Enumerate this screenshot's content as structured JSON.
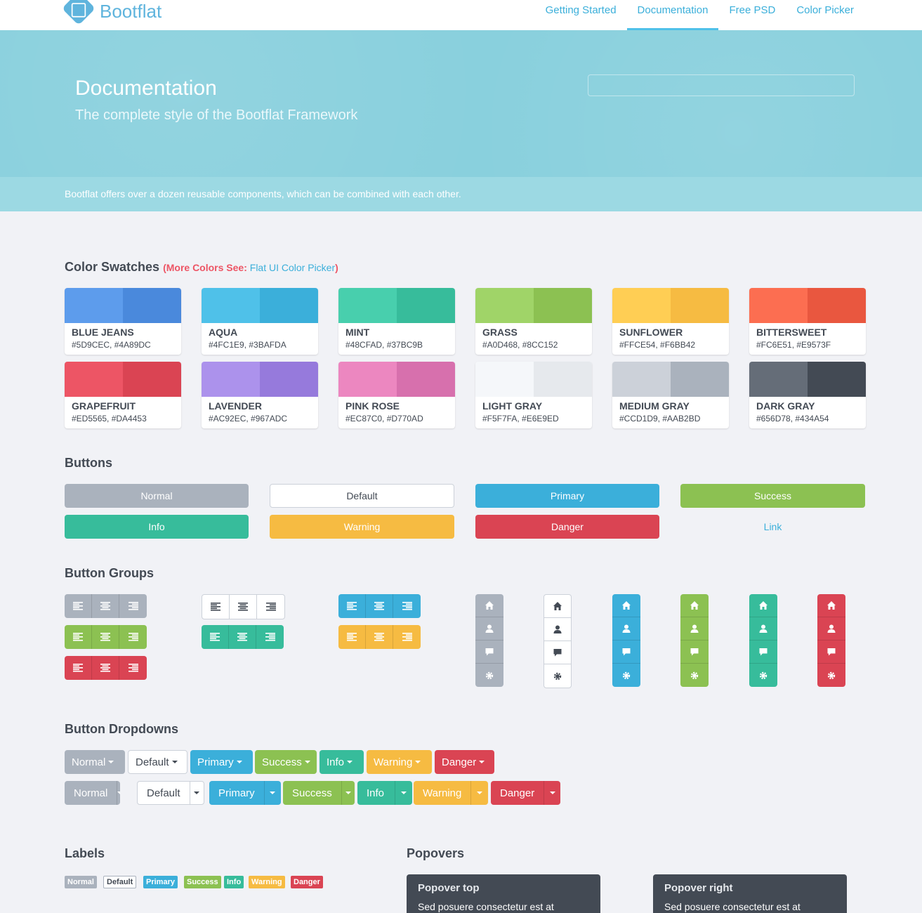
{
  "brand": {
    "name": "Bootflat"
  },
  "nav": [
    "Getting Started",
    "Documentation",
    "Free PSD",
    "Color Picker"
  ],
  "hero": {
    "title": "Documentation",
    "subtitle": "The complete style of the Bootflat Framework",
    "search_placeholder": ""
  },
  "subhero": "Bootflat offers over a dozen reusable components, which can be combined with each other.",
  "swatches_section": {
    "title": "Color Swatches",
    "more": "(More Colors See: ",
    "link": "Flat UI Color Picker",
    "close": ")"
  },
  "swatches": [
    {
      "name": "BLUE JEANS",
      "hex": "#5D9CEC, #4A89DC",
      "c1": "#5d9cec",
      "c2": "#4a89dc"
    },
    {
      "name": "AQUA",
      "hex": "#4FC1E9, #3BAFDA",
      "c1": "#4fc1e9",
      "c2": "#3bafda"
    },
    {
      "name": "MINT",
      "hex": "#48CFAD, #37BC9B",
      "c1": "#48cfad",
      "c2": "#37bc9b"
    },
    {
      "name": "GRASS",
      "hex": "#A0D468, #8CC152",
      "c1": "#a0d468",
      "c2": "#8cc152"
    },
    {
      "name": "SUNFLOWER",
      "hex": "#FFCE54, #F6BB42",
      "c1": "#ffce54",
      "c2": "#f6bb42"
    },
    {
      "name": "BITTERSWEET",
      "hex": "#FC6E51, #E9573F",
      "c1": "#fc6e51",
      "c2": "#e9573f"
    },
    {
      "name": "GRAPEFRUIT",
      "hex": "#ED5565, #DA4453",
      "c1": "#ed5565",
      "c2": "#da4453"
    },
    {
      "name": "LAVENDER",
      "hex": "#AC92EC, #967ADC",
      "c1": "#ac92ec",
      "c2": "#967adc"
    },
    {
      "name": "PINK ROSE",
      "hex": "#EC87C0, #D770AD",
      "c1": "#ec87c0",
      "c2": "#d770ad"
    },
    {
      "name": "LIGHT GRAY",
      "hex": "#F5F7FA, #E6E9ED",
      "c1": "#f5f7fa",
      "c2": "#e6e9ed"
    },
    {
      "name": "MEDIUM GRAY",
      "hex": "#CCD1D9, #AAB2BD",
      "c1": "#ccd1d9",
      "c2": "#aab2bd"
    },
    {
      "name": "DARK GRAY",
      "hex": "#656D78, #434A54",
      "c1": "#656d78",
      "c2": "#434a54"
    }
  ],
  "buttons_section": {
    "title": "Buttons"
  },
  "buttons": [
    "Normal",
    "Default",
    "Primary",
    "Success",
    "Info",
    "Warning",
    "Danger",
    "Link"
  ],
  "button_groups_section": {
    "title": "Button Groups"
  },
  "button_dropdowns_section": {
    "title": "Button Dropdowns"
  },
  "dropdowns": [
    "Normal",
    "Default",
    "Primary",
    "Success",
    "Info",
    "Warning",
    "Danger"
  ],
  "labels_section": {
    "title": "Labels"
  },
  "labels": [
    "Normal",
    "Default",
    "Primary",
    "Success",
    "Info",
    "Warning",
    "Danger"
  ],
  "popovers_section": {
    "title": "Popovers"
  },
  "popovers": [
    {
      "title": "Popover top",
      "content": "Sed posuere consectetur est at"
    },
    {
      "title": "Popover right",
      "content": "Sed posuere consectetur est at"
    }
  ],
  "colors": {
    "normal": "#aab2bd",
    "default": "#ffffff",
    "primary": "#3bafda",
    "success": "#8cc152",
    "info": "#37bc9b",
    "warning": "#f6bb42",
    "danger": "#da4453",
    "link": "#3bafda"
  },
  "icons": {
    "align": [
      "align-left-icon",
      "align-center-icon",
      "align-right-icon"
    ],
    "vertical": [
      "home-icon",
      "user-icon",
      "comment-icon",
      "gear-icon"
    ]
  }
}
